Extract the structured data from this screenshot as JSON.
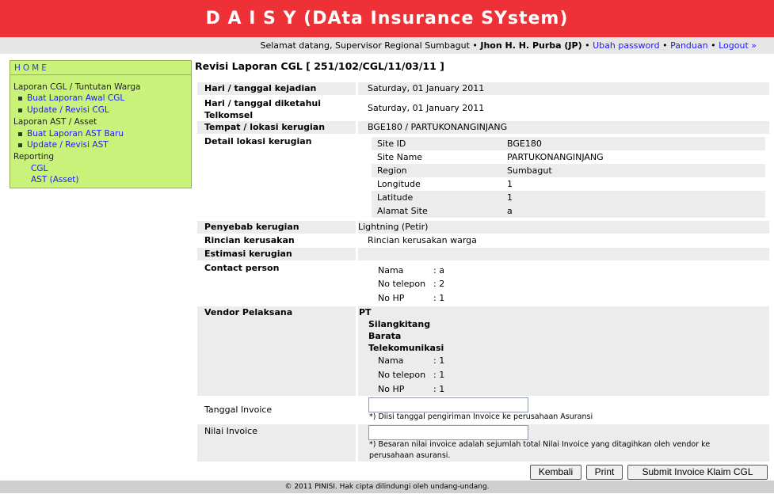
{
  "app": {
    "title": "D A I S Y (DAta Insurance SYstem)"
  },
  "userbar": {
    "welcome_text": "Selamat datang, Supervisor Regional Sumbagut •",
    "user_name": "Jhon H. H. Purba (JP)",
    "sep1": "•",
    "change_password": "Ubah password",
    "sep2": "•",
    "guide": "Panduan",
    "sep3": "•",
    "logout": "Logout »"
  },
  "sidebar": {
    "home": "HOME",
    "section_cgl": "Laporan CGL / Tuntutan Warga",
    "cgl_new": "Buat Laporan Awal CGL",
    "cgl_update": "Update / Revisi CGL",
    "section_ast": "Laporan AST / Asset",
    "ast_new": "Buat Laporan AST Baru",
    "ast_update": "Update / Revisi AST",
    "section_reporting": "Reporting",
    "report_cgl": "CGL",
    "report_ast": "AST (Asset)"
  },
  "page": {
    "title": "Revisi Laporan CGL [ 251/102/CGL/11/03/11 ]"
  },
  "form": {
    "incident_date_label": "Hari / tanggal kejadian",
    "incident_date_value": "Saturday, 01 January 2011",
    "known_date_label": "Hari / tanggal diketahui Telkomsel",
    "known_date_value": "Saturday, 01 January 2011",
    "location_label": "Tempat / lokasi kerugian",
    "location_value": "BGE180 / PARTUKONANGINJANG",
    "location_detail_label": "Detail lokasi kerugian",
    "site_details": [
      {
        "key": "Site ID",
        "value": "BGE180"
      },
      {
        "key": "Site Name",
        "value": "PARTUKONANGINJANG"
      },
      {
        "key": "Region",
        "value": "Sumbagut"
      },
      {
        "key": "Longitude",
        "value": "1"
      },
      {
        "key": "Latitude",
        "value": "1"
      },
      {
        "key": "Alamat Site",
        "value": "a"
      }
    ],
    "cause_label": "Penyebab kerugian",
    "cause_value": "Lightning (Petir)",
    "damage_label": "Rincian kerusakan",
    "damage_value": "Rincian kerusakan warga",
    "estimate_label": "Estimasi kerugian",
    "estimate_value": "",
    "contact_label": "Contact person",
    "contact": [
      {
        "key": "Nama",
        "value": ": a"
      },
      {
        "key": "No telepon",
        "value": ": 2"
      },
      {
        "key": "No HP",
        "value": ": 1"
      }
    ],
    "vendor_label": "Vendor Pelaksana",
    "vendor_name_lines": [
      "PT",
      "Silangkitang",
      "Barata",
      "Telekomunikasi"
    ],
    "vendor_contact": [
      {
        "key": "Nama",
        "value": ": 1"
      },
      {
        "key": "No telepon",
        "value": ": 1"
      },
      {
        "key": "No HP",
        "value": ": 1"
      }
    ],
    "invoice_date_label": "Tanggal Invoice",
    "invoice_date_value": "",
    "invoice_date_hint": "*) Diisi tanggal pengiriman Invoice ke perusahaan Asuransi",
    "invoice_amount_label": "Nilai Invoice",
    "invoice_amount_value": "",
    "invoice_amount_hint_1": "*) Besaran nilai invoice adalah sejumlah total Nilai Invoice yang ditagihkan oleh vendor ke",
    "invoice_amount_hint_2": "perusahaan asuransi."
  },
  "buttons": {
    "back": "Kembali",
    "print": "Print",
    "submit": "Submit Invoice Klaim CGL"
  },
  "footer": {
    "text": "© 2011 PINISI. Hak cipta dilindungi oleh undang-undang."
  }
}
